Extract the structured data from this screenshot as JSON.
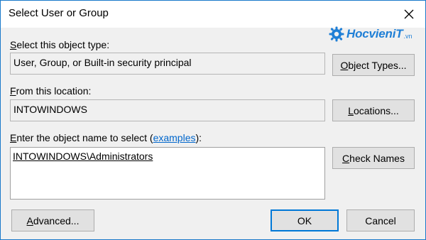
{
  "window": {
    "title": "Select User or Group",
    "close_icon": "close-icon"
  },
  "watermark": {
    "text": "HocvieniT",
    "suffix": ".vn",
    "icon": "gear-icon",
    "color": "#1f7fd6"
  },
  "object_type": {
    "label_key": "S",
    "label_rest": "elect this object type:",
    "value": "User, Group, or Built-in security principal",
    "button_key": "O",
    "button_rest": "bject Types..."
  },
  "location": {
    "label_key": "F",
    "label_rest": "rom this location:",
    "value": "INTOWINDOWS",
    "button_key": "L",
    "button_rest": "ocations..."
  },
  "object_name": {
    "label_key": "E",
    "label_rest": "nter the object name to select (",
    "link": "examples",
    "label_end": "):",
    "value": "INTOWINDOWS\\Administrators",
    "button_key": "C",
    "button_rest": "heck Names"
  },
  "footer": {
    "advanced_key": "A",
    "advanced_rest": "dvanced...",
    "ok_label": "OK",
    "cancel_label": "Cancel"
  },
  "colors": {
    "accent": "#0078d7",
    "window_border": "#1979ca",
    "link": "#0066cc"
  }
}
